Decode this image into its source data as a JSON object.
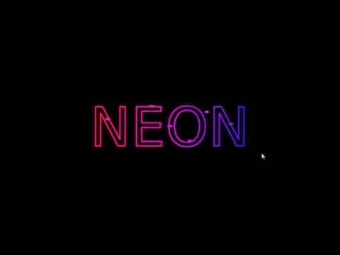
{
  "neon_text": "NEON",
  "colors": {
    "background": "#000000",
    "gradient_start": "#ff1f4f",
    "gradient_mid": "#cc22cc",
    "gradient_end": "#3a1fd6",
    "highlight": "#ff66ff"
  },
  "icons": {
    "pointer": "mouse-pointer-icon"
  }
}
